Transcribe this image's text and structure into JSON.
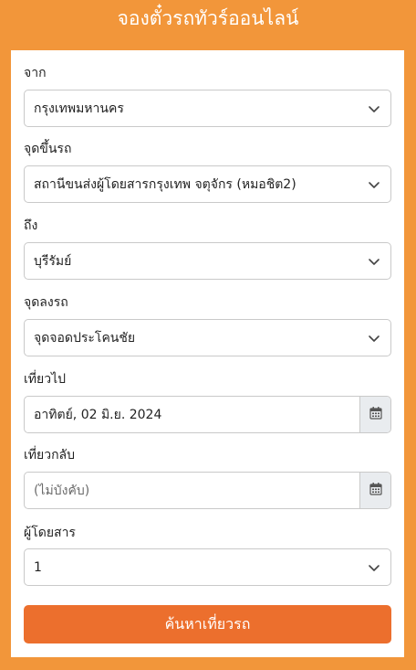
{
  "header": {
    "title": "จองตั๋วรถทัวร์ออนไลน์"
  },
  "form": {
    "from": {
      "label": "จาก",
      "value": "กรุงเทพมหานคร"
    },
    "pickup": {
      "label": "จุดขึ้นรถ",
      "value": "สถานีขนส่งผู้โดยสารกรุงเทพ จตุจักร (หมอชิต2)"
    },
    "to": {
      "label": "ถึง",
      "value": "บุรีรัมย์"
    },
    "dropoff": {
      "label": "จุดลงรถ",
      "value": "จุดจอดประโคนชัย"
    },
    "depart": {
      "label": "เที่ยวไป",
      "value": "อาทิตย์, 02 มิ.ย. 2024"
    },
    "return": {
      "label": "เที่ยวกลับ",
      "placeholder": "(ไม่บังคับ)"
    },
    "passengers": {
      "label": "ผู้โดยสาร",
      "value": "1"
    },
    "search_label": "ค้นหาเที่ยวรถ"
  },
  "colors": {
    "background": "#f2963a",
    "button": "#ec6f2d",
    "card": "#ffffff"
  },
  "icons": {
    "dropdown": "chevron-down-icon",
    "calendar": "calendar-icon"
  }
}
